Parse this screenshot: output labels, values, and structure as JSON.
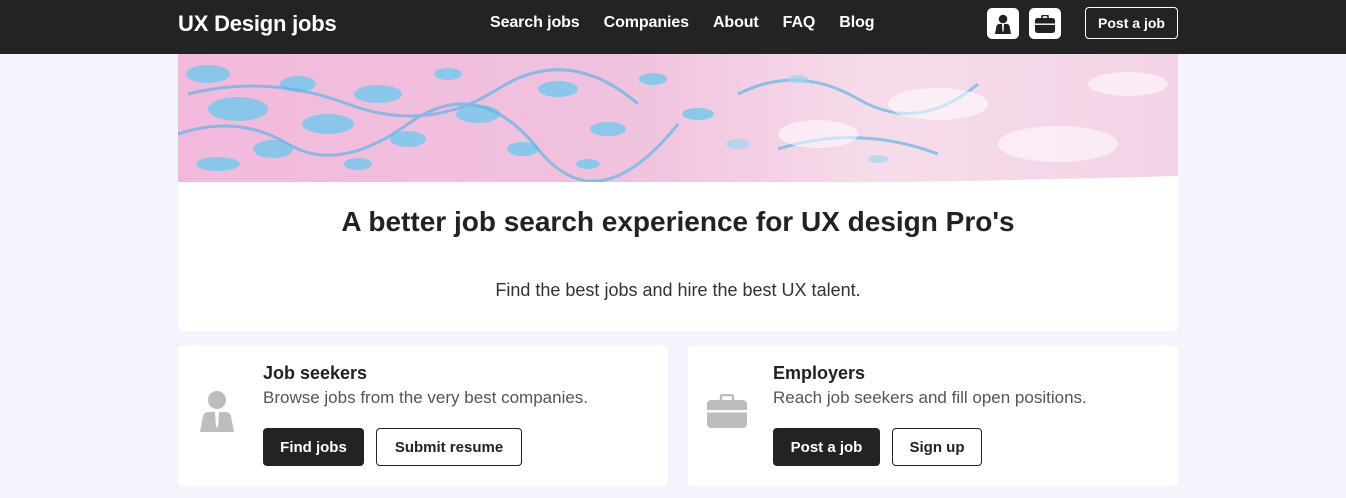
{
  "header": {
    "brand": "UX Design jobs",
    "nav": [
      "Search jobs",
      "Companies",
      "About",
      "FAQ",
      "Blog"
    ],
    "icons": [
      "user-icon",
      "briefcase-icon"
    ],
    "post_job": "Post a job"
  },
  "hero": {
    "title": "A better job search experience for UX design Pro's",
    "subtitle": "Find the best jobs and hire the best UX talent."
  },
  "cards": {
    "seekers": {
      "title": "Job seekers",
      "description": "Browse jobs from the very best companies.",
      "primary": "Find jobs",
      "secondary": "Submit resume"
    },
    "employers": {
      "title": "Employers",
      "description": "Reach job seekers and fill open positions.",
      "primary": "Post a job",
      "secondary": "Sign up"
    }
  },
  "colors": {
    "header_bg": "#232323",
    "page_bg": "#f4f4fc",
    "accent_pink": "#f0b8dc",
    "accent_blue": "#7fc8ec"
  }
}
